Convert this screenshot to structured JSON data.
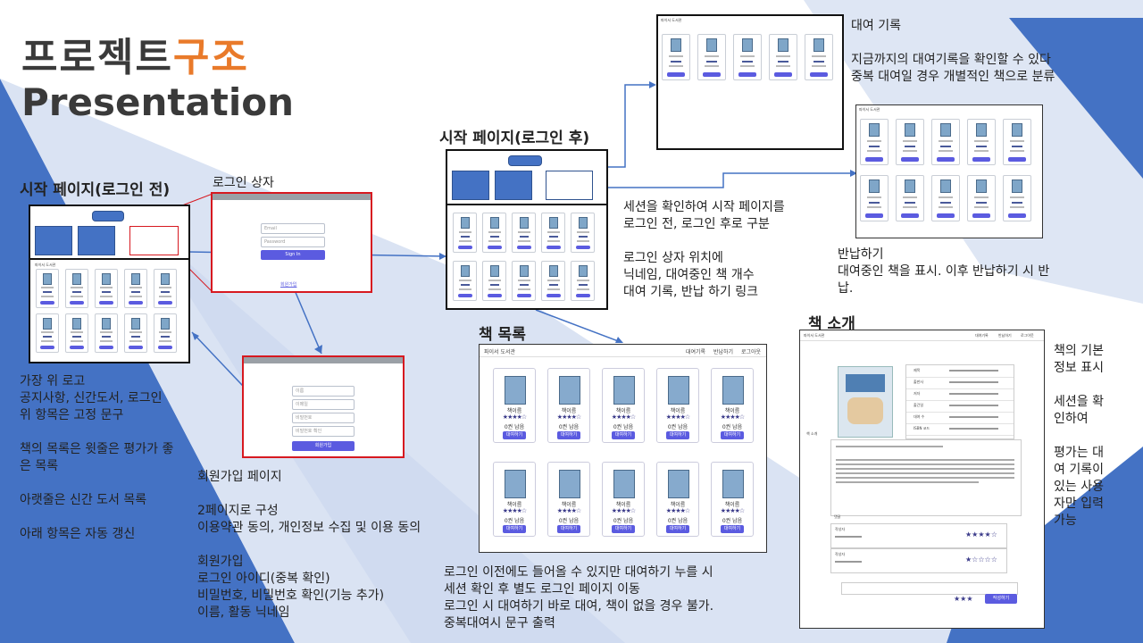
{
  "title": {
    "main_prefix": "프로젝트",
    "main_accent": "구조",
    "subtitle": "Presentation"
  },
  "colors": {
    "accent": "#e97a2a",
    "blue_bg": "#4472c4",
    "light_bg": "#dae3f3",
    "frame_red": "#d71920",
    "button": "#5b5be0"
  },
  "pre_login": {
    "heading": "시작 페이지(로그인 전)",
    "notes": "가장 위 로고\n공지사항, 신간도서, 로그인\n위 항목은 고정 문구\n\n책의 목록은 윗줄은 평가가 좋\n은 목록\n\n아랫줄은 신간 도서 목록\n\n아래 항목은 자동 갱신"
  },
  "login_box": {
    "heading": "로그인 상자",
    "email_placeholder": "Email",
    "password_placeholder": "Password",
    "signin_label": "Sign In",
    "signup_link": "회원가입"
  },
  "signup_page": {
    "fields": [
      "이름",
      "이메일",
      "비밀번호",
      "비밀번호 확인"
    ],
    "button_label": "회원가입",
    "notes": "회원가입 페이지\n\n2페이지로 구성\n이용약관 동의, 개인정보 수집 및 이용 동의\n\n회원가입\n로그인 아이디(중복 확인)\n비밀번호, 비밀번호 확인(기능 추가)\n이름, 활동 닉네임"
  },
  "post_login": {
    "heading": "시작 페이지(로그인 후)",
    "notes": "세션을 확인하여 시작 페이지를\n로그인 전, 로그인 후로 구분\n\n로그인 상자 위치에\n닉네임, 대여중인 책 개수\n대여 기록, 반납 하기 링크"
  },
  "rental_history": {
    "notes": "대여 기록\n\n지금까지의 대여기록을 확인할 수 있다\n중복 대여일 경우 개별적인 책으로 분류"
  },
  "return_page": {
    "notes": "반납하기\n대여중인 책을 표시. 이후 반납하기 시 반\n납."
  },
  "book_list": {
    "heading": "책 목록",
    "site_name": "파이서 도서관",
    "nav": [
      "대여기록",
      "반납하기",
      "로그아웃"
    ],
    "card_name": "책이름",
    "card_stars": "★★★★☆",
    "card_count": "0권 남음",
    "card_button": "대여하기",
    "notes": "로그인 이전에도 들어올 수 있지만 대여하기 누를 시\n세션 확인 후 별도 로그인 페이지 이동\n로그인 시 대여하기 바로 대여, 책이 없을 경우 불가.\n중복대여시 문구 출력"
  },
  "book_intro": {
    "heading": "책 소개",
    "nav": [
      "대여기록",
      "반납하기",
      "로그아웃"
    ],
    "info_labels": [
      "제목",
      "출판사",
      "저자",
      "출간일",
      "대여 수",
      "ISBN 코드"
    ],
    "section_intro": "책 소개",
    "section_review": "댓글",
    "review_names": [
      "작성자",
      "작성자"
    ],
    "submit_label": "작성하기",
    "notes": "책의 기본\n정보 표시\n\n세션을 확\n인하여\n\n평가는 대\n여 기록이\n있는 사용\n자만 입력\n가능"
  }
}
